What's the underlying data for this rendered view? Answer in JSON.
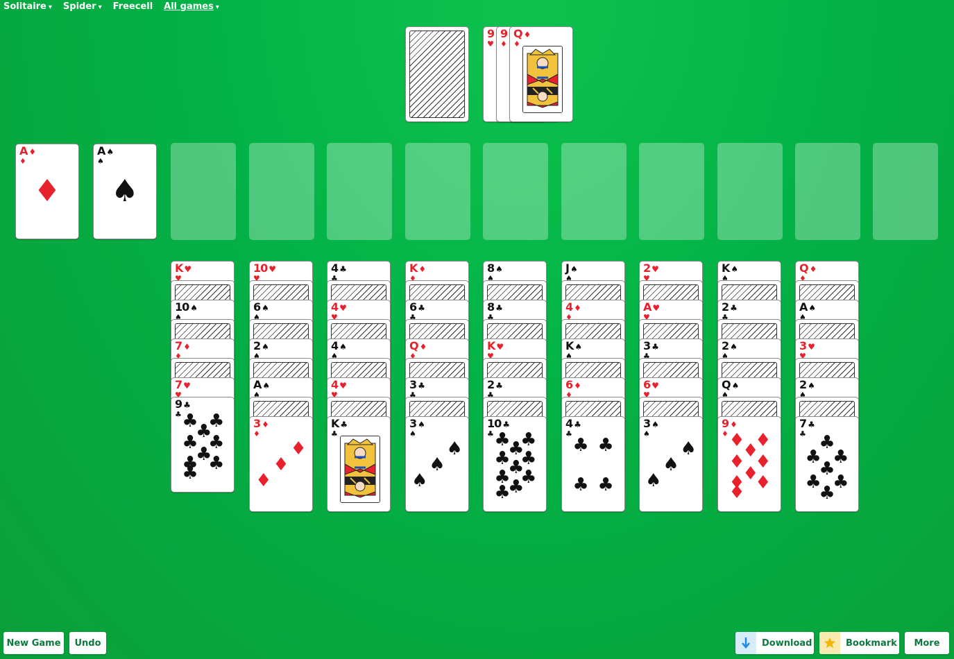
{
  "menu": [
    {
      "label": "Solitaire",
      "caret": "▾",
      "active": false
    },
    {
      "label": "Spider",
      "caret": "▾",
      "active": false
    },
    {
      "label": "Freecell",
      "caret": "",
      "active": false
    },
    {
      "label": "All games",
      "caret": "▾",
      "active": true
    }
  ],
  "stock": {
    "face_down": true
  },
  "waste": [
    {
      "rank": "9",
      "suit": "♥",
      "color": "red"
    },
    {
      "rank": "9",
      "suit": "♦",
      "color": "red"
    },
    {
      "rank": "Q",
      "suit": "♦",
      "color": "red",
      "face": "queen"
    }
  ],
  "foundations": [
    {
      "rank": "A",
      "suit": "♦",
      "color": "red"
    },
    {
      "rank": "A",
      "suit": "♠",
      "color": "black"
    },
    null,
    null,
    null,
    null,
    null,
    null,
    null,
    null,
    null,
    null
  ],
  "tableau": [
    {
      "cards": [
        {
          "rank": "K",
          "suit": "♥",
          "color": "red"
        },
        {
          "down": true
        },
        {
          "rank": "10",
          "suit": "♠",
          "color": "black"
        },
        {
          "down": true
        },
        {
          "rank": "7",
          "suit": "♦",
          "color": "red"
        },
        {
          "down": true
        },
        {
          "rank": "7",
          "suit": "♥",
          "color": "red"
        },
        {
          "rank": "9",
          "suit": "♣",
          "color": "black"
        }
      ]
    },
    {
      "cards": [
        {
          "rank": "10",
          "suit": "♥",
          "color": "red"
        },
        {
          "down": true
        },
        {
          "rank": "6",
          "suit": "♠",
          "color": "black"
        },
        {
          "down": true
        },
        {
          "rank": "2",
          "suit": "♠",
          "color": "black"
        },
        {
          "down": true
        },
        {
          "rank": "A",
          "suit": "♠",
          "color": "black"
        },
        {
          "down": true
        },
        {
          "rank": "3",
          "suit": "♦",
          "color": "red"
        }
      ]
    },
    {
      "cards": [
        {
          "rank": "4",
          "suit": "♣",
          "color": "black"
        },
        {
          "down": true
        },
        {
          "rank": "4",
          "suit": "♥",
          "color": "red"
        },
        {
          "down": true
        },
        {
          "rank": "4",
          "suit": "♠",
          "color": "black"
        },
        {
          "down": true
        },
        {
          "rank": "4",
          "suit": "♥",
          "color": "red"
        },
        {
          "down": true
        },
        {
          "rank": "K",
          "suit": "♣",
          "color": "black",
          "face": "king"
        }
      ]
    },
    {
      "cards": [
        {
          "rank": "K",
          "suit": "♦",
          "color": "red"
        },
        {
          "down": true
        },
        {
          "rank": "6",
          "suit": "♣",
          "color": "black"
        },
        {
          "down": true
        },
        {
          "rank": "Q",
          "suit": "♦",
          "color": "red"
        },
        {
          "down": true
        },
        {
          "rank": "3",
          "suit": "♣",
          "color": "black"
        },
        {
          "down": true
        },
        {
          "rank": "3",
          "suit": "♠",
          "color": "black"
        }
      ]
    },
    {
      "cards": [
        {
          "rank": "8",
          "suit": "♠",
          "color": "black"
        },
        {
          "down": true
        },
        {
          "rank": "8",
          "suit": "♣",
          "color": "black"
        },
        {
          "down": true
        },
        {
          "rank": "K",
          "suit": "♥",
          "color": "red"
        },
        {
          "down": true
        },
        {
          "rank": "2",
          "suit": "♣",
          "color": "black"
        },
        {
          "down": true
        },
        {
          "rank": "10",
          "suit": "♣",
          "color": "black"
        }
      ]
    },
    {
      "cards": [
        {
          "rank": "J",
          "suit": "♠",
          "color": "black"
        },
        {
          "down": true
        },
        {
          "rank": "4",
          "suit": "♦",
          "color": "red"
        },
        {
          "down": true
        },
        {
          "rank": "K",
          "suit": "♠",
          "color": "black"
        },
        {
          "down": true
        },
        {
          "rank": "6",
          "suit": "♦",
          "color": "red"
        },
        {
          "down": true
        },
        {
          "rank": "4",
          "suit": "♣",
          "color": "black"
        }
      ]
    },
    {
      "cards": [
        {
          "rank": "2",
          "suit": "♥",
          "color": "red"
        },
        {
          "down": true
        },
        {
          "rank": "A",
          "suit": "♥",
          "color": "red"
        },
        {
          "down": true
        },
        {
          "rank": "3",
          "suit": "♣",
          "color": "black"
        },
        {
          "down": true
        },
        {
          "rank": "6",
          "suit": "♥",
          "color": "red"
        },
        {
          "down": true
        },
        {
          "rank": "3",
          "suit": "♠",
          "color": "black"
        }
      ]
    },
    {
      "cards": [
        {
          "rank": "K",
          "suit": "♠",
          "color": "black"
        },
        {
          "down": true
        },
        {
          "rank": "2",
          "suit": "♣",
          "color": "black"
        },
        {
          "down": true
        },
        {
          "rank": "2",
          "suit": "♠",
          "color": "black"
        },
        {
          "down": true
        },
        {
          "rank": "Q",
          "suit": "♠",
          "color": "black"
        },
        {
          "down": true
        },
        {
          "rank": "9",
          "suit": "♦",
          "color": "red"
        }
      ]
    },
    {
      "cards": [
        {
          "rank": "Q",
          "suit": "♦",
          "color": "red"
        },
        {
          "down": true
        },
        {
          "rank": "A",
          "suit": "♠",
          "color": "black"
        },
        {
          "down": true
        },
        {
          "rank": "3",
          "suit": "♥",
          "color": "red"
        },
        {
          "down": true
        },
        {
          "rank": "2",
          "suit": "♠",
          "color": "black"
        },
        {
          "down": true
        },
        {
          "rank": "7",
          "suit": "♣",
          "color": "black"
        }
      ]
    }
  ],
  "buttons": {
    "new_game": "New Game",
    "undo": "Undo",
    "download": "Download",
    "bookmark": "Bookmark",
    "more": "More"
  },
  "icons": {
    "download": "download-arrow-icon",
    "bookmark": "star-icon"
  },
  "colors": {
    "felt": "#03b347",
    "button_text": "#0c7a3c",
    "red_suit": "#e8222c",
    "download_icon_bg": "#d6ecf8",
    "bookmark_icon_bg": "#f7e9b0"
  }
}
